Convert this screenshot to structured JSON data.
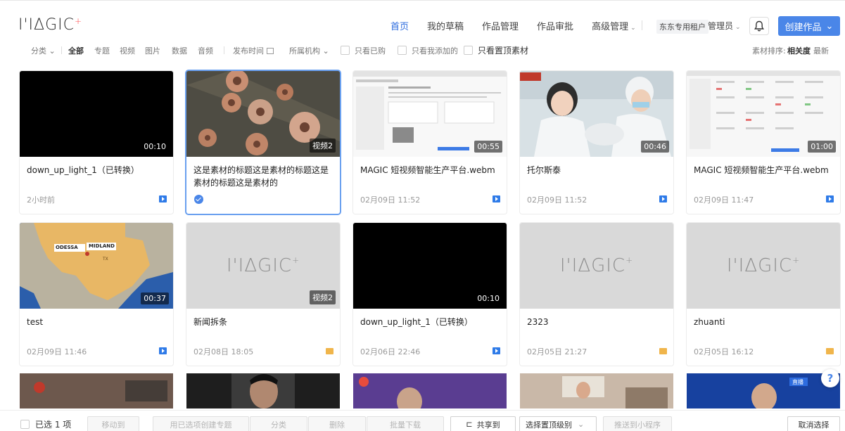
{
  "logo": {
    "text": "I'IΔGIC",
    "plus": "+"
  },
  "nav": {
    "items": [
      "首页",
      "我的草稿",
      "作品管理",
      "作品审批",
      "高级管理"
    ],
    "advanced_caret": "⌄",
    "tenant": "东东专用租户",
    "role": "管理员",
    "role_caret": "⌄",
    "create_label": "创建作品",
    "create_caret": "⌄"
  },
  "filters": {
    "category": "分类",
    "category_caret": "⌄",
    "types": [
      "全部",
      "专题",
      "视频",
      "图片",
      "数据",
      "音频"
    ],
    "publish_time": "发布时间",
    "org": "所属机构",
    "only_bought": "只看已购",
    "only_mine": "只看我添加的",
    "only_pinned": "只看置顶素材",
    "sort_label": "素材排序:",
    "sort_relevance": "相关度",
    "sort_latest": "最新"
  },
  "cards": [
    {
      "title": "down_up_light_1（已转换）",
      "time": "2小时前",
      "badge": "00:10",
      "type": "video",
      "thumb": "black"
    },
    {
      "title": "这是素材的标题这是素材的标题这是素材的标题这是素材的",
      "time": "",
      "badge": "视频2",
      "type": "selected",
      "thumb": "pots"
    },
    {
      "title": "MAGIC 短视频智能生产平台.webm",
      "time": "02月09日 11:52",
      "badge": "00:55",
      "type": "video",
      "thumb": "screen"
    },
    {
      "title": "托尔斯泰",
      "time": "02月09日 11:52",
      "badge": "00:46",
      "type": "video",
      "thumb": "hospital"
    },
    {
      "title": "MAGIC 短视频智能生产平台.webm",
      "time": "02月09日 11:47",
      "badge": "01:00",
      "type": "video",
      "thumb": "screen2"
    },
    {
      "title": "test",
      "time": "02月09日 11:46",
      "badge": "00:37",
      "type": "video",
      "thumb": "map"
    },
    {
      "title": "新闻拆条",
      "time": "02月08日 18:05",
      "badge": "视频2",
      "type": "folder",
      "thumb": "placeholder"
    },
    {
      "title": "down_up_light_1（已转换）",
      "time": "02月06日 22:46",
      "badge": "00:10",
      "type": "video",
      "thumb": "black"
    },
    {
      "title": "2323",
      "time": "02月05日 21:27",
      "badge": "",
      "type": "folder",
      "thumb": "placeholder"
    },
    {
      "title": "zhuanti",
      "time": "02月05日 16:12",
      "badge": "",
      "type": "folder",
      "thumb": "placeholder"
    }
  ],
  "map_labels": {
    "a": "ODESSA",
    "b": "MIDLAND",
    "c": "TX"
  },
  "placeholder_logo": {
    "text": "I'IΔGIC",
    "plus": "+"
  },
  "peek_badge": "直播",
  "actions": {
    "selected": "已选 1 项",
    "move": "移动到",
    "create_topic": "用已选项创建专题",
    "category": "分类",
    "delete": "删除",
    "bulk_download": "批量下载",
    "share": "共享到",
    "pin_level": "选择置顶级别",
    "push_mini": "推送到小程序",
    "cancel": "取消选择"
  },
  "help": "?",
  "colors": {
    "accent": "#4a86e8",
    "nav_active": "#2d6cdf",
    "video_icon": "#2f7be8",
    "folder_icon": "#f0b54b"
  }
}
